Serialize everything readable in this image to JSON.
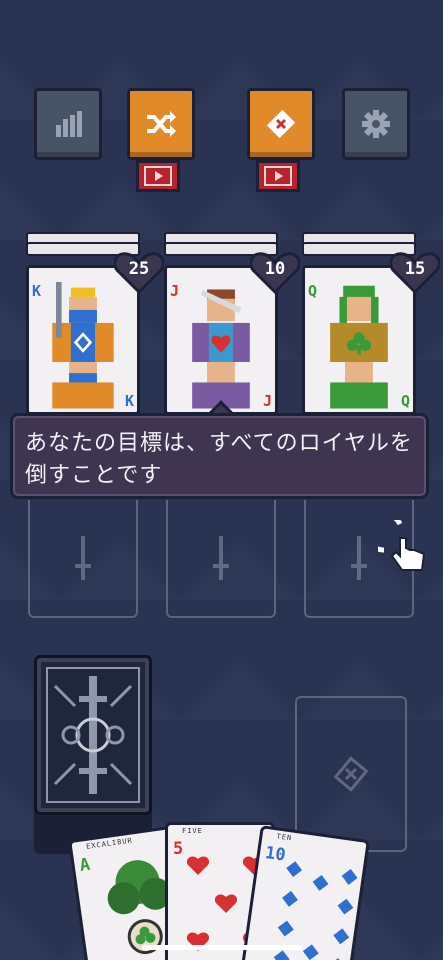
{
  "toolbar": {
    "stats_icon": "bar-chart-icon",
    "shuffle_icon": "shuffle-icon",
    "discard_icon": "card-x-icon",
    "settings_icon": "gear-icon",
    "ad_icon": "video-ad-icon",
    "colors": {
      "grey": "#475468",
      "orange": "#e08a2a",
      "ad_red": "#b8232b"
    }
  },
  "royals": [
    {
      "rank": "K",
      "suit": "diamond",
      "health": "25",
      "color": "#2f6fcf"
    },
    {
      "rank": "J",
      "suit": "heart",
      "health": "10",
      "color": "#d83030"
    },
    {
      "rank": "Q",
      "suit": "club",
      "health": "15",
      "color": "#3a9a3a"
    }
  ],
  "tooltip": {
    "text": "あなたの目標は、すべてのロイヤルを倒すことです"
  },
  "hand": [
    {
      "rank": "A",
      "caption": "EXCALIBUR",
      "suit": "club",
      "color": "#3a9a3a"
    },
    {
      "rank": "5",
      "caption": "FIVE",
      "suit": "heart",
      "color": "#d83030"
    },
    {
      "rank": "10",
      "caption": "TEN",
      "suit": "diamond",
      "color": "#2f6fcf"
    }
  ],
  "icons": {
    "slot": "sword-icon",
    "discard": "discard-pile-icon",
    "hint": "tap-hand-icon"
  }
}
